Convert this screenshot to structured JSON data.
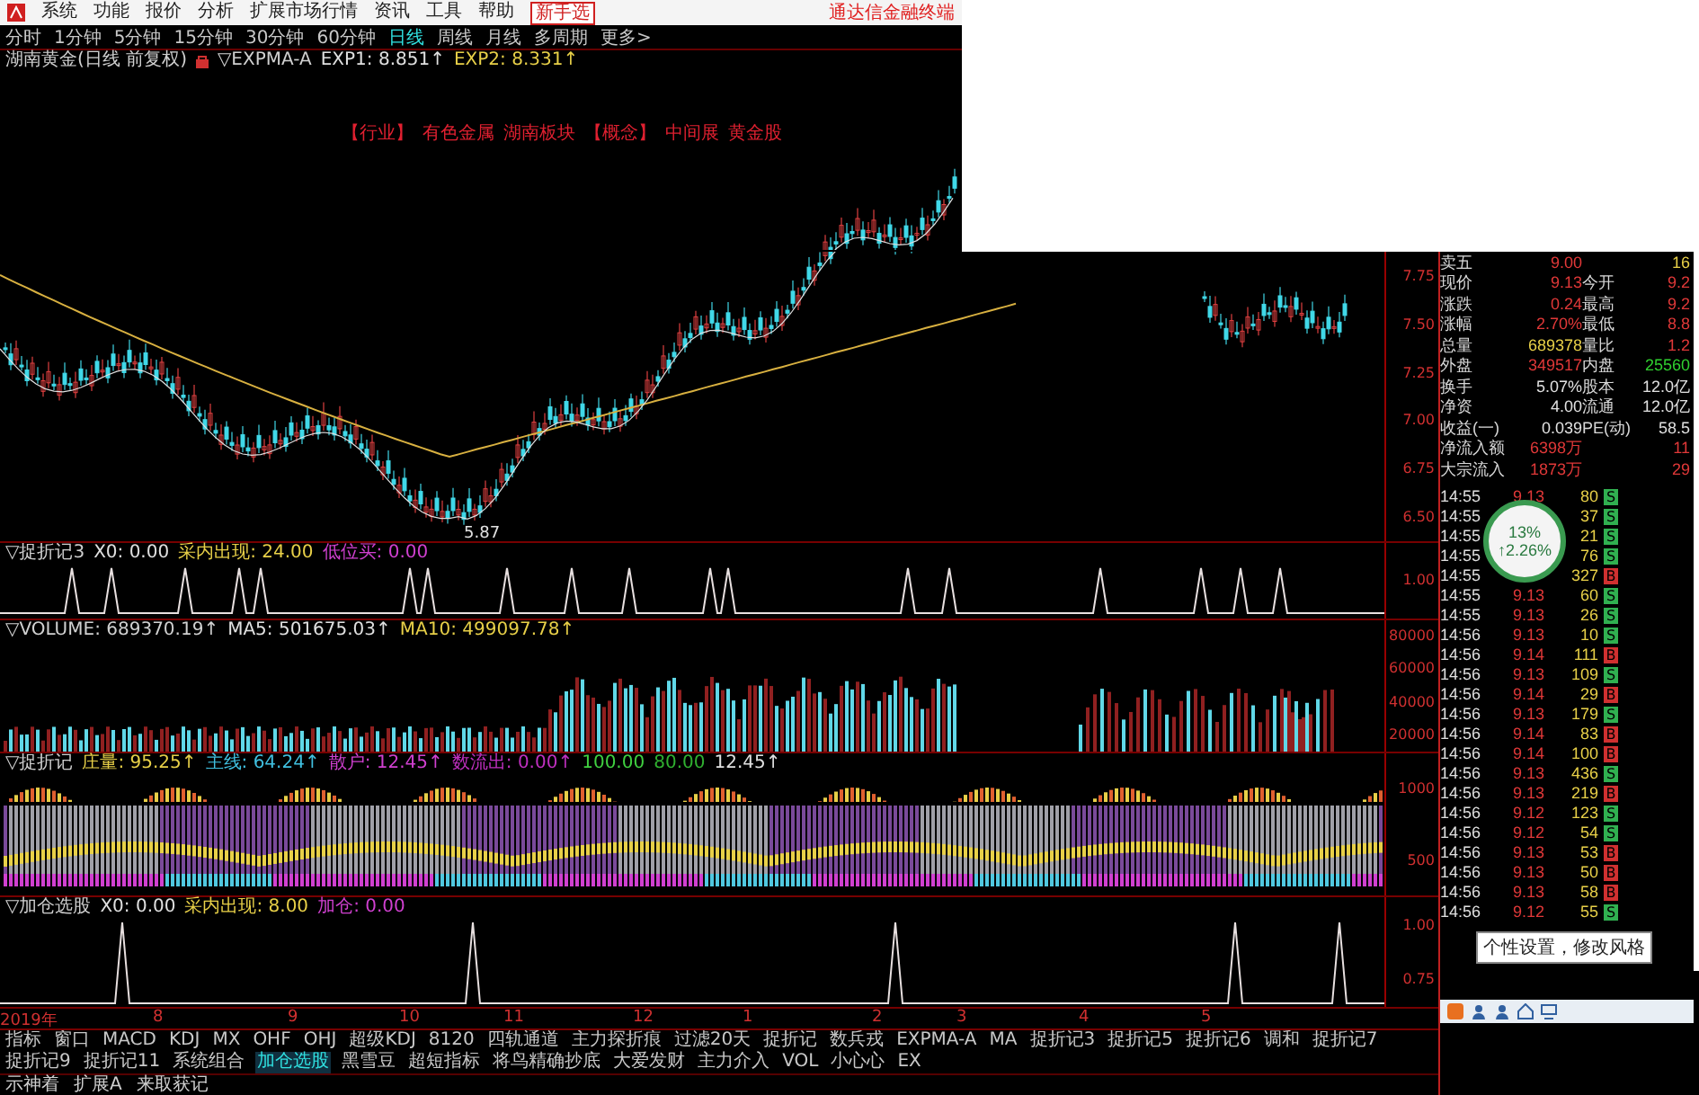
{
  "menu_bar": {
    "items": [
      "系统",
      "功能",
      "报价",
      "分析",
      "扩展市场行情",
      "资讯",
      "工具",
      "帮助"
    ],
    "highlight": "新手选",
    "app_name": "通达信金融终端"
  },
  "periods": [
    {
      "label": "分时",
      "selected": false
    },
    {
      "label": "1分钟",
      "selected": false
    },
    {
      "label": "5分钟",
      "selected": false
    },
    {
      "label": "15分钟",
      "selected": false
    },
    {
      "label": "30分钟",
      "selected": false
    },
    {
      "label": "60分钟",
      "selected": false
    },
    {
      "label": "日线",
      "selected": true
    },
    {
      "label": "周线",
      "selected": false
    },
    {
      "label": "月线",
      "selected": false
    },
    {
      "label": "多周期",
      "selected": false
    },
    {
      "label": "更多>",
      "selected": false
    }
  ],
  "chart_title": {
    "stock": "湖南黄金(日线 前复权)",
    "indicator": "▽EXPMA-A",
    "values": [
      {
        "text": "EXP1: 8.851↑",
        "color": "#e0e0e0"
      },
      {
        "text": "EXP2: 8.331↑",
        "color": "#e8d048"
      }
    ]
  },
  "annotation_tags": [
    "【行业】",
    "有色金属",
    "湖南板块",
    "【概念】",
    "中间展",
    "黄金股"
  ],
  "low_label": "5.87",
  "price_axis": [
    "7.75",
    "7.50",
    "7.25",
    "7.00",
    "6.75",
    "6.50"
  ],
  "panes": [
    {
      "kind": "spikes",
      "title": "▽捉折记3",
      "values": [
        {
          "text": "X0: 0.00",
          "color": "#e0e0e0"
        },
        {
          "text": "采内出现: 24.00",
          "color": "#e8d048"
        },
        {
          "text": "低位买: 0.00",
          "color": "#d040d0"
        }
      ],
      "axis": [
        "1.00"
      ]
    },
    {
      "kind": "volume",
      "title": "▽VOLUME: 689370.19↑",
      "values": [
        {
          "text": "MA5: 501675.03↑",
          "color": "#e0e0e0"
        },
        {
          "text": "MA10: 499097.78↑",
          "color": "#e8d048"
        }
      ],
      "axis": [
        "80000",
        "60000",
        "40000",
        "20000"
      ]
    },
    {
      "kind": "flow",
      "title": "▽捉折记",
      "values": [
        {
          "text": "庄量: 95.25↑",
          "color": "#e8d048"
        },
        {
          "text": "主线: 64.24↑",
          "color": "#40c0e0"
        },
        {
          "text": "散户: 12.45↑",
          "color": "#d040d0"
        },
        {
          "text": "数流出: 0.00↑",
          "color": "#c030c0"
        },
        {
          "text": "100.00",
          "color": "#40d040"
        },
        {
          "text": "80.00",
          "color": "#30b030"
        },
        {
          "text": "12.45↑",
          "color": "#e0e0e0"
        }
      ],
      "axis": [
        "1000",
        "500"
      ]
    },
    {
      "kind": "signals",
      "title": "▽加仓选股",
      "values": [
        {
          "text": "X0: 0.00",
          "color": "#e0e0e0"
        },
        {
          "text": "采内出现: 8.00",
          "color": "#e8d048"
        },
        {
          "text": "加仓: 0.00",
          "color": "#d040d0"
        }
      ],
      "axis": [
        "1.00",
        "0.75"
      ]
    }
  ],
  "date_axis": [
    "2019年",
    "8",
    "9",
    "10",
    "11",
    "12",
    "1",
    "2",
    "3",
    "4",
    "5"
  ],
  "tabs": [
    {
      "label": "指标",
      "selected": false
    },
    {
      "label": "窗口",
      "selected": false
    },
    {
      "label": "MACD",
      "selected": false
    },
    {
      "label": "KDJ",
      "selected": false
    },
    {
      "label": "MX",
      "selected": false
    },
    {
      "label": "OHF",
      "selected": false
    },
    {
      "label": "OHJ",
      "selected": false
    },
    {
      "label": "超级KDJ",
      "selected": false
    },
    {
      "label": "8120",
      "selected": false
    },
    {
      "label": "四轨通道",
      "selected": false
    },
    {
      "label": "主力探折痕",
      "selected": false
    },
    {
      "label": "过滤20天",
      "selected": false
    },
    {
      "label": "捉折记",
      "selected": false
    },
    {
      "label": "数兵戎",
      "selected": false
    },
    {
      "label": "EXPMA-A",
      "selected": false
    },
    {
      "label": "MA",
      "selected": false
    },
    {
      "label": "捉折记3",
      "selected": false
    },
    {
      "label": "捉折记5",
      "selected": false
    },
    {
      "label": "捉折记6",
      "selected": false
    },
    {
      "label": "调和",
      "selected": false
    },
    {
      "label": "捉折记7",
      "selected": false
    },
    {
      "label": "捉折记9",
      "selected": false
    },
    {
      "label": "捉折记11",
      "selected": false
    },
    {
      "label": "系统组合",
      "selected": false
    },
    {
      "label": "加仓选股",
      "selected": true
    },
    {
      "label": "黑雪豆",
      "selected": false
    },
    {
      "label": "超短指标",
      "selected": false
    },
    {
      "label": "将鸟精确抄底",
      "selected": false
    },
    {
      "label": "大爱发财",
      "selected": false
    },
    {
      "label": "主力介入",
      "selected": false
    },
    {
      "label": "VOL",
      "selected": false
    },
    {
      "label": "小心心",
      "selected": false
    },
    {
      "label": "EX",
      "selected": false
    }
  ],
  "bottom_bar": [
    "示神着",
    "扩展A",
    "来取获记"
  ],
  "quote_rows": [
    {
      "label": "卖五",
      "value": {
        "text": "9.00",
        "kind": "up"
      },
      "value2": {
        "text": "16",
        "kind": "volume"
      }
    },
    {
      "label": "现价",
      "value": {
        "text": "9.13",
        "kind": "up"
      },
      "label2": "今开",
      "value2": {
        "text": "9.2",
        "kind": "up"
      }
    },
    {
      "label": "涨跌",
      "value": {
        "text": "0.24",
        "kind": "up"
      },
      "label2": "最高",
      "value2": {
        "text": "9.2",
        "kind": "up"
      }
    },
    {
      "label": "涨幅",
      "value": {
        "text": "2.70%",
        "kind": "up"
      },
      "label2": "最低",
      "value2": {
        "text": "8.8",
        "kind": "up"
      }
    },
    {
      "label": "总量",
      "value": {
        "text": "689378",
        "kind": "volume"
      },
      "label2": "量比",
      "value2": {
        "text": "1.2",
        "kind": "up"
      }
    },
    {
      "label": "外盘",
      "value": {
        "text": "349517",
        "kind": "up"
      },
      "label2": "内盘",
      "value2": {
        "text": "25560",
        "kind": "down"
      }
    },
    {
      "label": "换手",
      "value": {
        "text": "5.07%",
        "kind": "flat"
      },
      "label2": "股本",
      "value2": {
        "text": "12.0亿",
        "kind": "flat"
      }
    },
    {
      "label": "净资",
      "value": {
        "text": "4.00",
        "kind": "flat"
      },
      "label2": "流通",
      "value2": {
        "text": "12.0亿",
        "kind": "flat"
      }
    },
    {
      "label": "收益(一)",
      "value": {
        "text": "0.039",
        "kind": "flat"
      },
      "label2": "PE(动)",
      "value2": {
        "text": "58.5",
        "kind": "flat"
      }
    },
    {
      "label": "净流入额",
      "value": {
        "text": "6398万",
        "kind": "up"
      },
      "value2": {
        "text": "11",
        "kind": "up"
      }
    },
    {
      "label": "大宗流入",
      "value": {
        "text": "1873万",
        "kind": "up"
      },
      "value2": {
        "text": "29",
        "kind": "up"
      }
    }
  ],
  "ticks": [
    {
      "time": "14:55",
      "price": "9.13",
      "volume": "80",
      "side": "S",
      "kind": "sell"
    },
    {
      "time": "14:55",
      "volume": "37",
      "side": "S",
      "kind": "sell"
    },
    {
      "time": "14:55",
      "volume": "21",
      "side": "S",
      "kind": "sell"
    },
    {
      "time": "14:55",
      "volume": "76",
      "side": "S",
      "kind": "sell"
    },
    {
      "time": "14:55",
      "volume": "327",
      "side": "B",
      "kind": "buy"
    },
    {
      "time": "14:55",
      "price": "9.13",
      "volume": "60",
      "side": "S",
      "kind": "sell"
    },
    {
      "time": "14:55",
      "price": "9.13",
      "volume": "26",
      "side": "S",
      "kind": "sell"
    },
    {
      "time": "14:56",
      "price": "9.13",
      "volume": "10",
      "side": "S",
      "kind": "sell"
    },
    {
      "time": "14:56",
      "price": "9.14",
      "volume": "111",
      "side": "B",
      "kind": "buy"
    },
    {
      "time": "14:56",
      "price": "9.13",
      "volume": "109",
      "side": "S",
      "kind": "sell"
    },
    {
      "time": "14:56",
      "price": "9.14",
      "volume": "29",
      "side": "B",
      "kind": "buy"
    },
    {
      "time": "14:56",
      "price": "9.13",
      "volume": "179",
      "side": "S",
      "kind": "sell"
    },
    {
      "time": "14:56",
      "price": "9.14",
      "volume": "83",
      "side": "B",
      "kind": "buy"
    },
    {
      "time": "14:56",
      "price": "9.14",
      "volume": "100",
      "side": "B",
      "kind": "buy"
    },
    {
      "time": "14:56",
      "price": "9.13",
      "volume": "436",
      "side": "S",
      "kind": "sell"
    },
    {
      "time": "14:56",
      "price": "9.13",
      "volume": "219",
      "side": "B",
      "kind": "buy"
    },
    {
      "time": "14:56",
      "price": "9.12",
      "volume": "123",
      "side": "S",
      "kind": "sell"
    },
    {
      "time": "14:56",
      "price": "9.12",
      "volume": "54",
      "side": "S",
      "kind": "sell"
    },
    {
      "time": "14:56",
      "price": "9.13",
      "volume": "53",
      "side": "B",
      "kind": "buy"
    },
    {
      "time": "14:56",
      "price": "9.13",
      "volume": "50",
      "side": "B",
      "kind": "buy"
    },
    {
      "time": "14:56",
      "price": "9.13",
      "volume": "58",
      "side": "B",
      "kind": "buy"
    },
    {
      "time": "14:56",
      "price": "9.12",
      "volume": "55",
      "side": "S",
      "kind": "sell"
    }
  ],
  "badge": {
    "percent": "13%",
    "sub": "↑2.26%"
  },
  "tooltip": "个性设置，修改风格"
}
